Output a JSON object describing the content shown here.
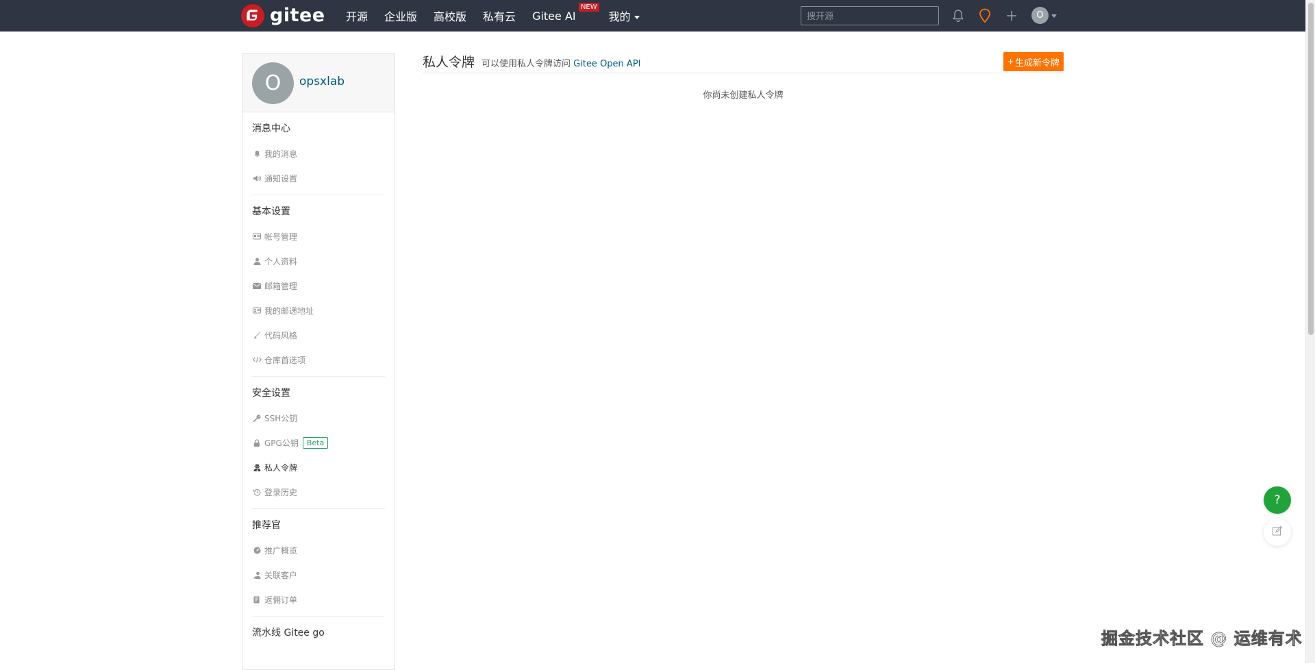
{
  "header": {
    "logo_text": "gitee",
    "nav": [
      "开源",
      "企业版",
      "高校版",
      "私有云",
      "Gitee AI",
      "我的"
    ],
    "new_badge": "NEW",
    "search_placeholder": "搜开源",
    "user_initial": "O",
    "icons": [
      "bell-icon",
      "map-pin-icon",
      "plus-icon"
    ],
    "colors": {
      "bar": "#2f3542",
      "brand": "#c71d23",
      "pin": "#fe7300"
    }
  },
  "sidebar": {
    "avatar_initial": "O",
    "username": "opsxlab",
    "sections": [
      {
        "title": "消息中心",
        "items": [
          {
            "label": "我的消息",
            "icon": "bell-icon"
          },
          {
            "label": "通知设置",
            "icon": "megaphone-icon"
          }
        ]
      },
      {
        "title": "基本设置",
        "items": [
          {
            "label": "帐号管理",
            "icon": "id-card-icon"
          },
          {
            "label": "个人资料",
            "icon": "user-icon"
          },
          {
            "label": "邮箱管理",
            "icon": "envelope-icon"
          },
          {
            "label": "我的邮递地址",
            "icon": "address-card-icon"
          },
          {
            "label": "代码风格",
            "icon": "brush-icon"
          },
          {
            "label": "仓库首选项",
            "icon": "code-icon"
          }
        ]
      },
      {
        "title": "安全设置",
        "items": [
          {
            "label": "SSH公钥",
            "icon": "key-icon"
          },
          {
            "label": "GPG公钥",
            "icon": "lock-icon",
            "badge": "Beta"
          },
          {
            "label": "私人令牌",
            "icon": "user-secret-icon",
            "active": true
          },
          {
            "label": "登录历史",
            "icon": "history-icon"
          }
        ]
      },
      {
        "title": "推荐官",
        "items": [
          {
            "label": "推广概览",
            "icon": "dashboard-icon"
          },
          {
            "label": "关联客户",
            "icon": "user-link-icon"
          },
          {
            "label": "返佣订单",
            "icon": "order-icon"
          }
        ]
      },
      {
        "title": "流水线 Gitee go",
        "items": []
      }
    ]
  },
  "main": {
    "title": "私人令牌",
    "desc_prefix": "可以使用私人令牌访问",
    "desc_link": "Gitee Open API",
    "generate_plus": "+",
    "generate_label": "生成新令牌",
    "empty_text": "你尚未创建私人令牌",
    "button_color": "#fe7300"
  },
  "floating": {
    "help_label": "?",
    "help_color": "#21a33a"
  },
  "watermark": "掘金技术社区 @ 运维有术"
}
